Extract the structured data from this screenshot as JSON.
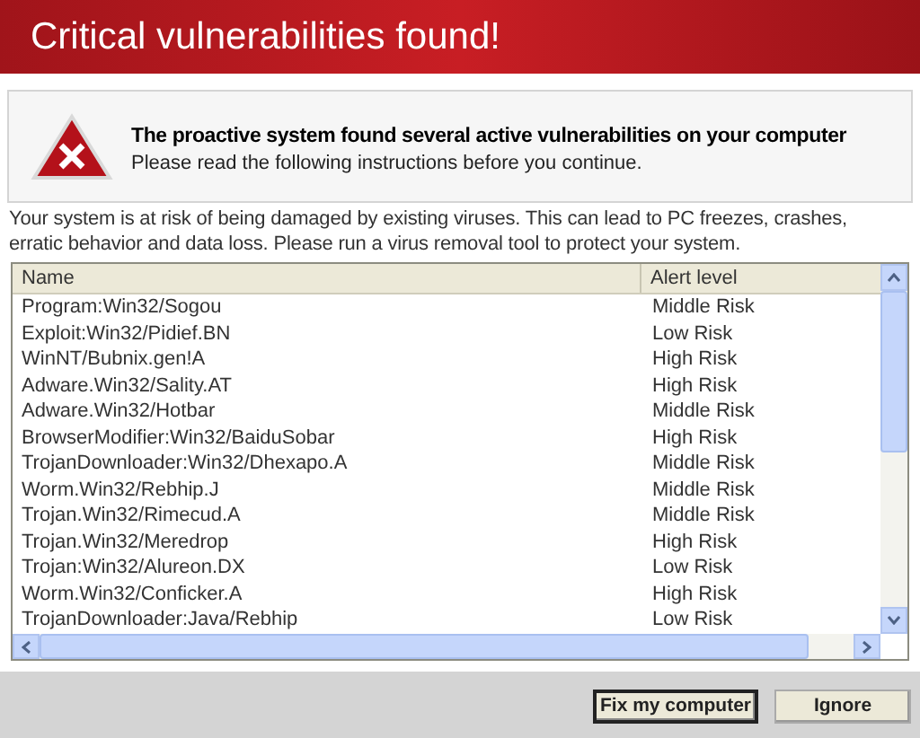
{
  "window": {
    "title": "Critical vulnerabilities found!"
  },
  "alert": {
    "heading": "The proactive system found several active vulnerabilities on your computer",
    "subtext": "Please read the following instructions before you continue."
  },
  "description": "Your system is at risk of being damaged by existing viruses. This can lead to PC freezes, crashes, erratic behavior and data loss. Please run a virus removal tool to protect your system.",
  "table": {
    "columns": [
      "Name",
      "Alert level"
    ],
    "rows": [
      {
        "name": "Program:Win32/Sogou",
        "alert_level": "Middle Risk"
      },
      {
        "name": "Exploit:Win32/Pidief.BN",
        "alert_level": "Low Risk"
      },
      {
        "name": "WinNT/Bubnix.gen!A",
        "alert_level": "High Risk"
      },
      {
        "name": "Adware.Win32/Sality.AT",
        "alert_level": "High Risk"
      },
      {
        "name": "Adware.Win32/Hotbar",
        "alert_level": "Middle Risk"
      },
      {
        "name": "BrowserModifier:Win32/BaiduSobar",
        "alert_level": "High Risk"
      },
      {
        "name": "TrojanDownloader:Win32/Dhexapo.A",
        "alert_level": "Middle Risk"
      },
      {
        "name": "Worm.Win32/Rebhip.J",
        "alert_level": "Middle Risk"
      },
      {
        "name": "Trojan.Win32/Rimecud.A",
        "alert_level": "Middle Risk"
      },
      {
        "name": "Trojan.Win32/Meredrop",
        "alert_level": "High Risk"
      },
      {
        "name": "Trojan:Win32/Alureon.DX",
        "alert_level": "Low Risk"
      },
      {
        "name": "Worm.Win32/Conficker.A",
        "alert_level": "High Risk"
      },
      {
        "name": "TrojanDownloader:Java/Rebhip",
        "alert_level": "Low Risk"
      }
    ]
  },
  "buttons": [
    {
      "label": "Fix my computer",
      "kind": "default"
    },
    {
      "label": "Ignore",
      "kind": "normal"
    }
  ]
}
